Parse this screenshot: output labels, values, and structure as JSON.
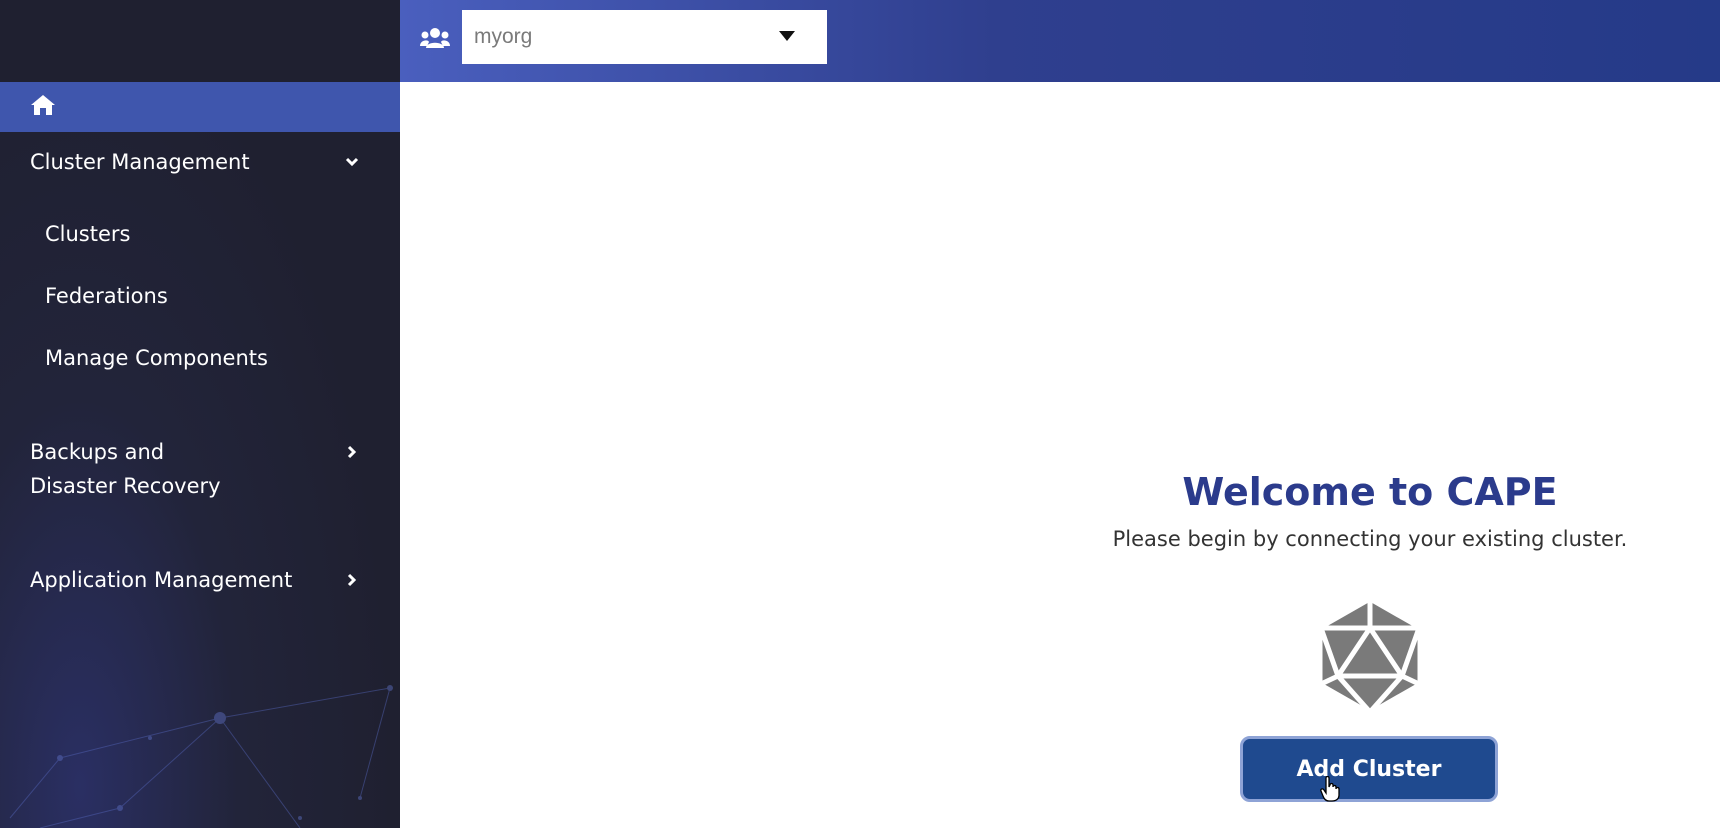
{
  "sidebar": {
    "home_icon": "home-icon",
    "items": [
      {
        "label": "Cluster Management",
        "icon": "chevron-down-icon",
        "expanded": true
      },
      {
        "label": "Backups and\nDisaster Recovery",
        "line1": "Backups and",
        "line2": "Disaster Recovery",
        "icon": "chevron-right-icon"
      },
      {
        "label": "Application Management",
        "icon": "chevron-right-icon"
      }
    ],
    "cluster_submenu": [
      "Clusters",
      "Federations",
      "Manage Components"
    ]
  },
  "header": {
    "org_icon": "users-icon",
    "org_select_value": "myorg",
    "caret_icon": "caret-down-icon"
  },
  "main": {
    "title": "Welcome to CAPE",
    "subtitle": "Please begin by connecting your existing cluster.",
    "cluster_icon": "icosahedron-icon",
    "add_button_label": "Add Cluster"
  },
  "colors": {
    "sidebar_bg": "#1f2030",
    "home_row": "#3f56ad",
    "title": "#2b3b8c",
    "button": "#1f4a8f"
  }
}
